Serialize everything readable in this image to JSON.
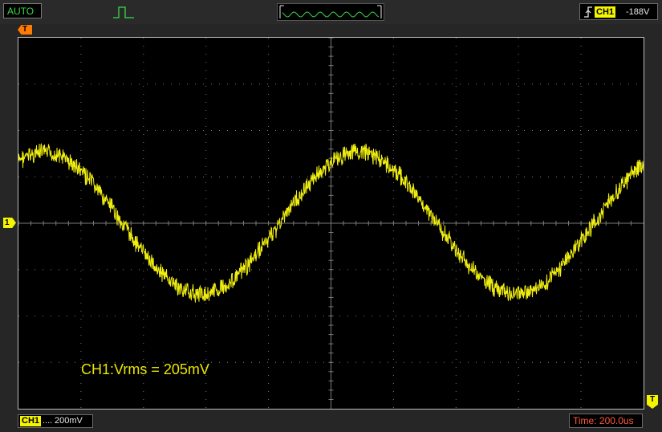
{
  "top_bar": {
    "acquire_mode": "AUTO",
    "pulse_icon": "pulse-waveform-icon",
    "overview_icon": "waveform-overview-icon",
    "trigger": {
      "edge_icon": "rising-edge-icon",
      "channel": "CH1",
      "level": "-188V"
    }
  },
  "markers": {
    "trigger_position": "T",
    "channel_zero": "1",
    "trigger_level": "T"
  },
  "screen": {
    "measurement": "CH1:Vrms = 205mV",
    "trace_color": "#f0ee10",
    "grid_color": "#7a7a7a"
  },
  "bottom_bar": {
    "channel": "CH1",
    "coupling": "....",
    "volts_per_div": "200mV",
    "timebase": "Time: 200.0us"
  }
}
